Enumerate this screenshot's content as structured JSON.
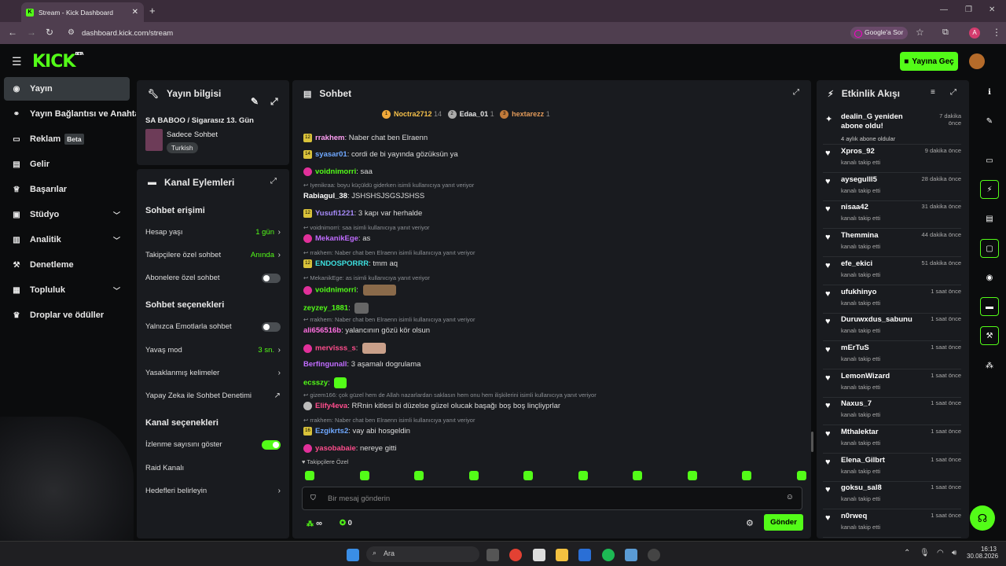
{
  "browser": {
    "tab_title": "Stream - Kick Dashboard",
    "url": "dashboard.kick.com/stream",
    "google_button": "Google'a Sor",
    "profile_initial": "A"
  },
  "header": {
    "logo": "KICK",
    "logo_badge": "BETA",
    "go_live": "Yayına Geç"
  },
  "sidebar": {
    "items": [
      {
        "label": "Yayın",
        "icon": "broadcast-icon"
      },
      {
        "label": "Yayın Bağlantısı ve Anahtar",
        "icon": "link-icon"
      },
      {
        "label": "Reklam",
        "icon": "ad-icon",
        "badge": "Beta"
      },
      {
        "label": "Gelir",
        "icon": "wallet-icon"
      },
      {
        "label": "Başarılar",
        "icon": "trophy-icon"
      },
      {
        "label": "Stüdyo",
        "icon": "studio-icon"
      },
      {
        "label": "Analitik",
        "icon": "chart-icon"
      },
      {
        "label": "Denetleme",
        "icon": "hammer-icon"
      },
      {
        "label": "Topluluk",
        "icon": "community-icon"
      },
      {
        "label": "Droplar ve ödüller",
        "icon": "gift-icon"
      }
    ]
  },
  "stream_info": {
    "title": "Yayın bilgisi",
    "stream_title": "SA BABOO / Sigarasız 13. Gün",
    "category": "Sadece Sohbet",
    "tag": "Turkish"
  },
  "channel_actions": {
    "title": "Kanal Eylemleri",
    "chat_access": "Sohbet erişimi",
    "account_age": "Hesap yaşı",
    "account_age_value": "1 gün",
    "followers_only": "Takipçilere özel sohbet",
    "followers_only_value": "Anında",
    "subscribers_only": "Abonelere özel sohbet",
    "chat_options": "Sohbet seçenekleri",
    "emotes_only": "Yalnızca Emotlarla sohbet",
    "slow_mode": "Yavaş mod",
    "slow_mode_value": "3 sn.",
    "banned_words": "Yasaklanmış kelimeler",
    "ai_moderation": "Yapay Zeka ile Sohbet Denetimi",
    "channel_options": "Kanal seçenekleri",
    "show_viewers": "İzlenme sayısını göster",
    "raid": "Raid Kanalı",
    "goals": "Hedefleri belirleyin"
  },
  "chat": {
    "title": "Sohbet",
    "leaders": [
      {
        "name": "Noctra2712",
        "count": "14"
      },
      {
        "name": "Edaa_01",
        "count": "1"
      },
      {
        "name": "hextarezz",
        "count": "1"
      }
    ],
    "messages": [
      {
        "badge": "12",
        "user": "rrakhem",
        "color": "#ff9ff3",
        "text": "Naber chat ben Elraenn"
      },
      {
        "badge": "14",
        "user": "syasar01",
        "color": "#6fa8ff",
        "text": "cordi de bi yayında gözüksün ya"
      },
      {
        "badge": "p",
        "user": "voidnimorri",
        "color": "#53fc18",
        "text": "saa"
      },
      {
        "reply": "Iyenikraa: boyu küçüldü giderken isimli kullanıcıya yanıt veriyor"
      },
      {
        "user": "Rabiagul_38",
        "color": "#ffffff",
        "text": "JSHSHSJSGSJSHSS"
      },
      {
        "badge": "12",
        "user": "Yusufi1221",
        "color": "#a78bfa",
        "text": "3 kapı var herhalde"
      },
      {
        "reply": "voidnimorri: saa isimli kullanıcıya yanıt veriyor"
      },
      {
        "badge": "p",
        "user": "MekanikEge",
        "color": "#c06cff",
        "text": "as"
      },
      {
        "reply": "rrakhem: Naber chat ben Elraenn isimli kullanıcıya yanıt veriyor"
      },
      {
        "badge": "12",
        "user": "ENDOSPORRR",
        "color": "#3de0e0",
        "text": "tmm aq"
      },
      {
        "reply": "MekanikEge: as isimli kullanıcıya yanıt veriyor"
      },
      {
        "badge": "p",
        "user": "voidnimorri",
        "color": "#53fc18",
        "text": ""
      },
      {
        "user": "zeyzey_1881",
        "color": "#53fc18",
        "text": ""
      },
      {
        "reply": "rrakhem: Naber chat ben Elraenn isimli kullanıcıya yanıt veriyor"
      },
      {
        "user": "ali656516b",
        "color": "#ff6fe0",
        "text": "yalancının gözü kör olsun"
      },
      {
        "badge": "p",
        "user": "mervisss_s",
        "color": "#ff4d8d",
        "text": ""
      },
      {
        "user": "Berfingunall",
        "color": "#c06cff",
        "text": "3 aşamalı dogrulama"
      },
      {
        "user": "ecsszy",
        "color": "#53fc18",
        "text": ""
      },
      {
        "reply": "gizem166: çok güzel hem de Allah nazarlardan saklasın hem onu hem ilişkilerini isimli kullanıcıya yanıt veriyor"
      },
      {
        "badge": "w",
        "user": "Elify4eva",
        "color": "#ff4d8d",
        "text": "RRnin kitlesi bi düzelse güzel olucak başağı boş boş linçliyprlar"
      },
      {
        "reply": "rrakhem: Naber chat ben Elraenn isimli kullanıcıya yanıt veriyor"
      },
      {
        "badge": "16",
        "user": "Ezgikrts2",
        "color": "#6fa8ff",
        "text": "vay abi hosgeldin"
      },
      {
        "badge": "p",
        "user": "yasobabaie",
        "color": "#ff4d8d",
        "text": "nereye gitti"
      }
    ],
    "followers_label": "Takipçilere Özel",
    "input_placeholder": "Bir mesaj gönderin",
    "points": "∞",
    "kicks": "0",
    "send": "Gönder"
  },
  "events": {
    "title": "Etkinlik Akışı",
    "items": [
      {
        "name": "dealin_G yeniden abone oldu!",
        "sub": "4 aylık abone oldular",
        "time": "7 dakika önce"
      },
      {
        "name": "Xpros_92",
        "sub": "kanalı takip etti",
        "time": "9 dakika önce"
      },
      {
        "name": "aysegulll5",
        "sub": "kanalı takip etti",
        "time": "28 dakika önce"
      },
      {
        "name": "nisaa42",
        "sub": "kanalı takip etti",
        "time": "31 dakika önce"
      },
      {
        "name": "Themmina",
        "sub": "kanalı takip etti",
        "time": "44 dakika önce"
      },
      {
        "name": "efe_ekici",
        "sub": "kanalı takip etti",
        "time": "51 dakika önce"
      },
      {
        "name": "ufukhinyo",
        "sub": "kanalı takip etti",
        "time": "1 saat önce"
      },
      {
        "name": "Duruwxdus_sabunu",
        "sub": "kanalı takip etti",
        "time": "1 saat önce"
      },
      {
        "name": "mErTuS",
        "sub": "kanalı takip etti",
        "time": "1 saat önce"
      },
      {
        "name": "LemonWizard",
        "sub": "kanalı takip etti",
        "time": "1 saat önce"
      },
      {
        "name": "Naxus_7",
        "sub": "kanalı takip etti",
        "time": "1 saat önce"
      },
      {
        "name": "Mthalektar",
        "sub": "kanalı takip etti",
        "time": "1 saat önce"
      },
      {
        "name": "Elena_Gilbrt",
        "sub": "kanalı takip etti",
        "time": "1 saat önce"
      },
      {
        "name": "goksu_sal8",
        "sub": "kanalı takip etti",
        "time": "1 saat önce"
      },
      {
        "name": "n0rweq",
        "sub": "kanalı takip etti",
        "time": "1 saat önce"
      }
    ]
  },
  "taskbar": {
    "search": "Ara",
    "time": "16:13",
    "date": "30.08.2026"
  }
}
